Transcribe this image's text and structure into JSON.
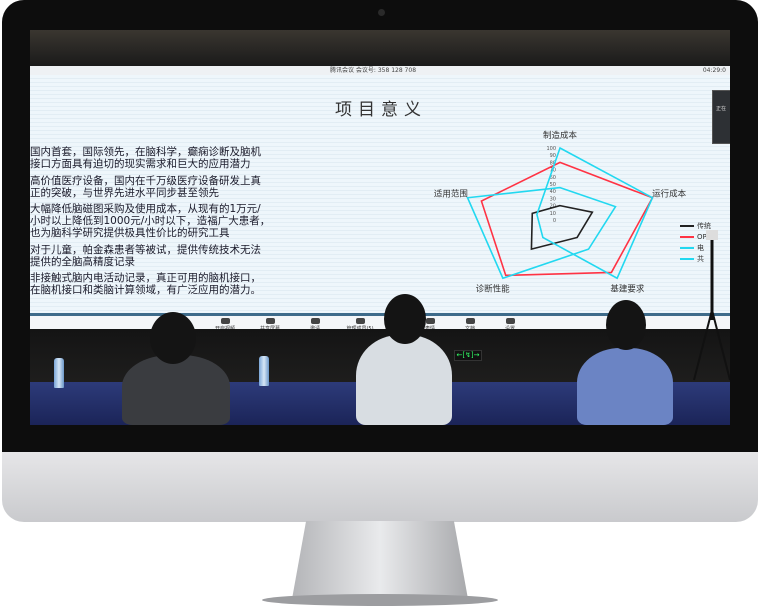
{
  "meeting_bar": {
    "info": "腾讯会议  会议号: 358 128 708",
    "time": "04:29:0"
  },
  "slide": {
    "title": "项目意义",
    "paragraphs": [
      "国内首套，国际领先，在脑科学，癫痫诊断及脑机\n接口方面具有迫切的现实需求和巨大的应用潜力",
      "高价值医疗设备，国内在千万级医疗设备研发上真\n正的突破，与世界先进水平同步甚至领先",
      "大幅降低脑磁图采购及使用成本，从现有的1万元/\n小时以上降低到1000元/小时以下，造福广大患者，\n也为脑科学研究提供极具性价比的研究工具",
      "对于儿童，帕金森患者等被试，提供传统技术无法\n提供的全脑高精度记录",
      "非接触式脑内电活动记录，真正可用的脑机接口，\n在脑机接口和类脑计算领域，有广泛应用的潜力。"
    ],
    "thumbnail_text": "正在"
  },
  "chart_data": {
    "type": "radar",
    "axes": [
      "制造成本",
      "运行成本",
      "基建要求",
      "诊断性能",
      "适用范围"
    ],
    "ticks": [
      "0",
      "10",
      "20",
      "30",
      "40",
      "50",
      "60",
      "70",
      "80",
      "90",
      "100"
    ],
    "range": [
      0,
      100
    ],
    "series": [
      {
        "name": "传统",
        "color": "#222222",
        "values": [
          20,
          35,
          30,
          50,
          30
        ]
      },
      {
        "name": "OPM",
        "color": "#ff3344",
        "values": [
          80,
          100,
          90,
          95,
          85
        ]
      },
      {
        "name": "电",
        "color": "#22d8f0",
        "values": [
          100,
          100,
          100,
          30,
          25
        ]
      },
      {
        "name": "共",
        "color": "#22d8f0",
        "values": [
          45,
          60,
          50,
          100,
          100
        ]
      }
    ],
    "legend": "right"
  },
  "toolbar": {
    "items": [
      {
        "label": "静音",
        "icon": "microphone-icon"
      },
      {
        "label": "开启视频",
        "icon": "video-off-icon"
      },
      {
        "label": "共享屏幕",
        "icon": "share-screen-icon"
      },
      {
        "label": "邀请",
        "icon": "invite-icon"
      },
      {
        "label": "管理成员(5)",
        "icon": "members-icon"
      },
      {
        "label": "表情",
        "icon": "emoji-icon"
      },
      {
        "label": "文档",
        "icon": "document-icon"
      },
      {
        "label": "设置",
        "icon": "settings-icon"
      }
    ]
  },
  "room": {
    "exit_sign": "←[↯]→"
  },
  "colors": {
    "bezel": "#0d0d0d",
    "chin": "#d9dadc",
    "desk_cloth": "#23307a",
    "toolbar_accent": "#3e6b8a"
  }
}
